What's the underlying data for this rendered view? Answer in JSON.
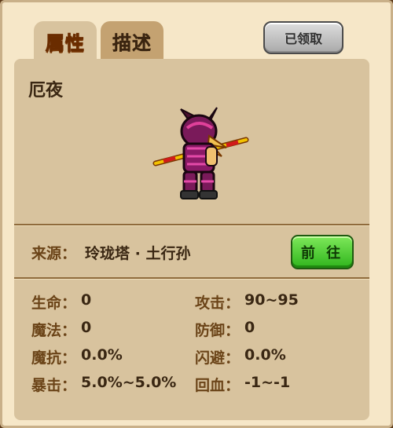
{
  "tabs": [
    {
      "label": "属性",
      "active": true
    },
    {
      "label": "描述",
      "active": false
    }
  ],
  "claim_button": {
    "label": "已领取",
    "state": "claimed"
  },
  "character": {
    "name": "厄夜",
    "sprite": "red-armored-warrior-with-staff"
  },
  "source": {
    "label": "来源",
    "value": "玲珑塔 · 土行孙",
    "go_button": "前 往"
  },
  "stats_left": [
    {
      "label": "生命",
      "value": "0"
    },
    {
      "label": "魔法",
      "value": "0"
    },
    {
      "label": "魔抗",
      "value": "0.0%"
    },
    {
      "label": "暴击",
      "value": "5.0%~5.0%"
    }
  ],
  "stats_right": [
    {
      "label": "攻击",
      "value": "90~95"
    },
    {
      "label": "防御",
      "value": "0"
    },
    {
      "label": "闪避",
      "value": "0.0%"
    },
    {
      "label": "回血",
      "value": "-1~-1"
    }
  ],
  "colors": {
    "panel_bg": "#f6e7c8",
    "content_bg": "#d8c39e",
    "active_tab_text": "#f6b100",
    "go_button": "#2fb51d",
    "claimed_button": "#a9a9a9"
  }
}
